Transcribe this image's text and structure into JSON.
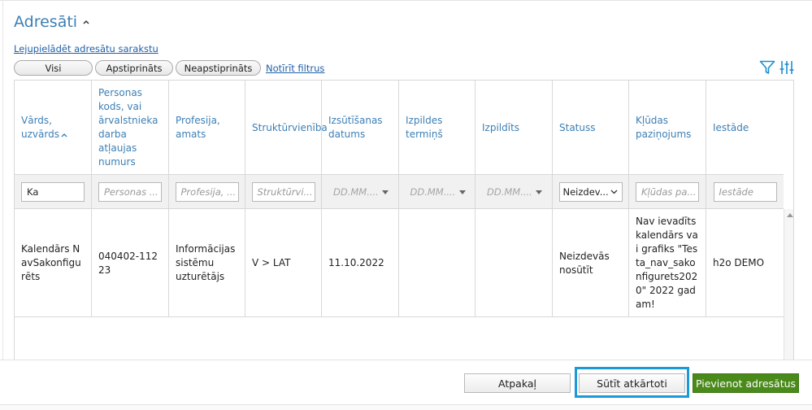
{
  "section": {
    "title": "Adresāti",
    "download_link": "Lejupielādēt adresātu sarakstu"
  },
  "filters": {
    "all": "Visi",
    "confirmed": "Apstiprināts",
    "unconfirmed": "Neapstiprināts",
    "clear": "Notīrīt filtrus"
  },
  "toolbar_icons": [
    "filter-icon",
    "column-settings-icon"
  ],
  "table": {
    "columns": [
      "Vārds, uzvārds",
      "Personas kods, vai ārvalstnieka darba atļaujas numurs",
      "Profesija, amats",
      "Struktūrvienība",
      "Izsūtīšanas datums",
      "Izpildes termiņš",
      "Izpildīts",
      "Statuss",
      "Kļūdas paziņojums",
      "Iestāde"
    ],
    "filter_row": {
      "name_value": "Ka",
      "person_code_placeholder": "Personas ...",
      "profession_placeholder": "Profesija, ...",
      "department_placeholder": "Struktūrvi...",
      "sent_date_placeholder": "DD.MM....",
      "due_date_placeholder": "DD.MM....",
      "done_placeholder": "DD.MM....",
      "status_value": "Neizdev...",
      "error_placeholder": "Kļūdas pa...",
      "institution_placeholder": "Iestāde"
    },
    "rows": [
      {
        "name": "Kalendārs NavSakonfigurēts",
        "person_code": "040402-11223",
        "profession": "Informācijas sistēmu uzturētājs",
        "department": "V > LAT",
        "sent_date": "11.10.2022",
        "due_date": "",
        "done": "",
        "status": "Neizdevās nosūtīt",
        "error": "Nav ievadīts kalendārs vai grafiks \"Testa_nav_sakonfigurets2020\" 2022 gadam!",
        "institution": "h2o DEMO"
      }
    ]
  },
  "buttons": {
    "back": "Atpakaļ",
    "resend": "Sūtīt atkārtoti",
    "add": "Pievienot adresātus"
  },
  "colors": {
    "accent": "#3d7fb5",
    "link": "#1f5fa8",
    "primary_button": "#4a8a1a",
    "highlight": "#1a9ad6"
  }
}
